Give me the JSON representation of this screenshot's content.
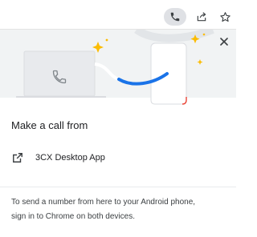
{
  "toolbar": {
    "icons": [
      "phone-icon",
      "share-icon",
      "star-icon"
    ]
  },
  "dialog": {
    "heading": "Make a call from",
    "app_label": "3CX Desktop App",
    "footer_line1": "To send a number from here to your Android phone,",
    "footer_line2": "sign in to Chrome on both devices."
  },
  "colors": {
    "accent_blue": "#1a73e8",
    "sparkle_yellow": "#fbbc04",
    "phone_red": "#ea4335"
  }
}
